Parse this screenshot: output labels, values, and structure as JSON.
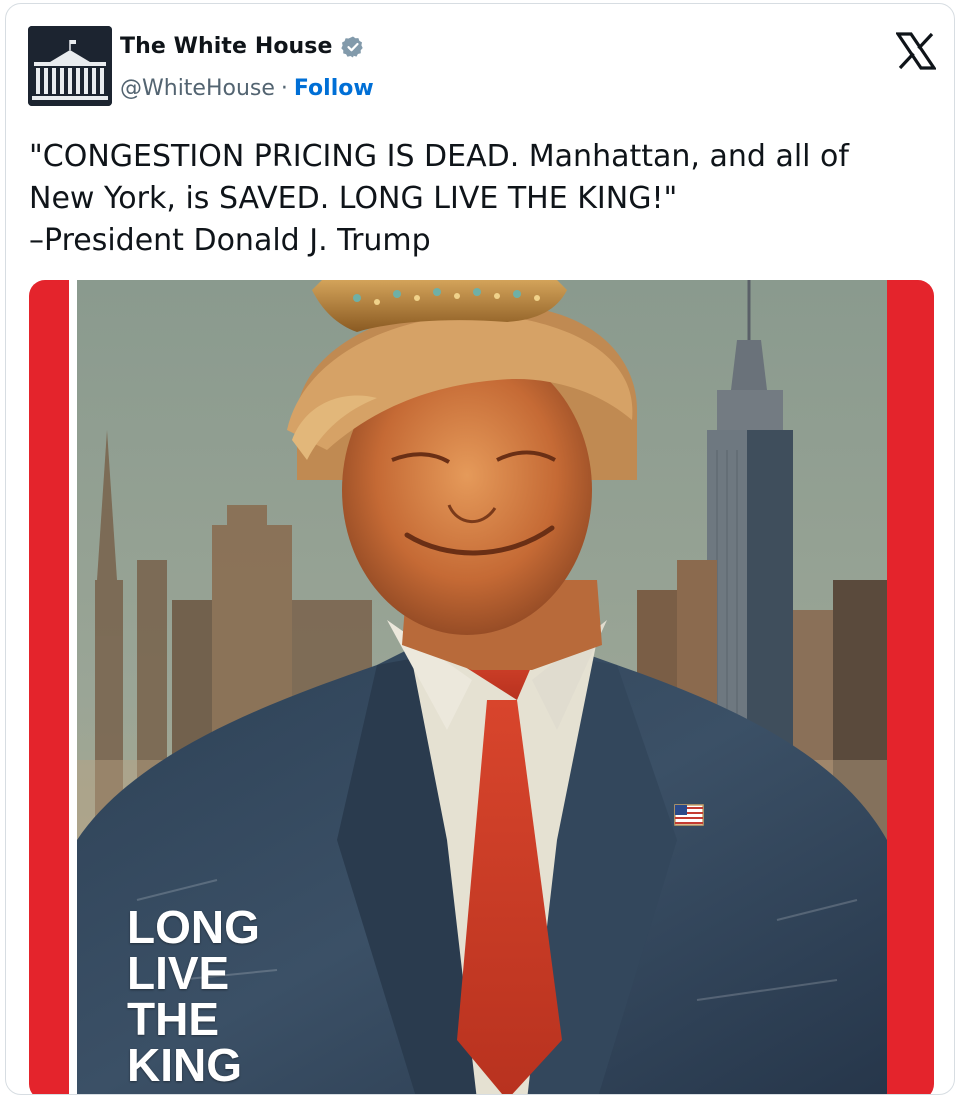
{
  "author": {
    "name": "The White House",
    "handle": "@WhiteHouse",
    "separator": "·",
    "follow_label": "Follow"
  },
  "tweet": {
    "text": "\"CONGESTION PRICING IS DEAD. Manhattan, and all of\nNew York, is SAVED. LONG LIVE THE KING!\"\n–President Donald J. Trump"
  },
  "media": {
    "cover_lines": [
      "LONG",
      "LIVE",
      "THE",
      "KING"
    ]
  },
  "icons": {
    "verified": "verified-badge-icon",
    "platform": "x-logo-icon"
  },
  "colors": {
    "border_red": "#e4242c",
    "verified_badge": "#829aab",
    "follow_link": "#006fd6",
    "text_primary": "#0f1419",
    "text_secondary": "#536471"
  }
}
